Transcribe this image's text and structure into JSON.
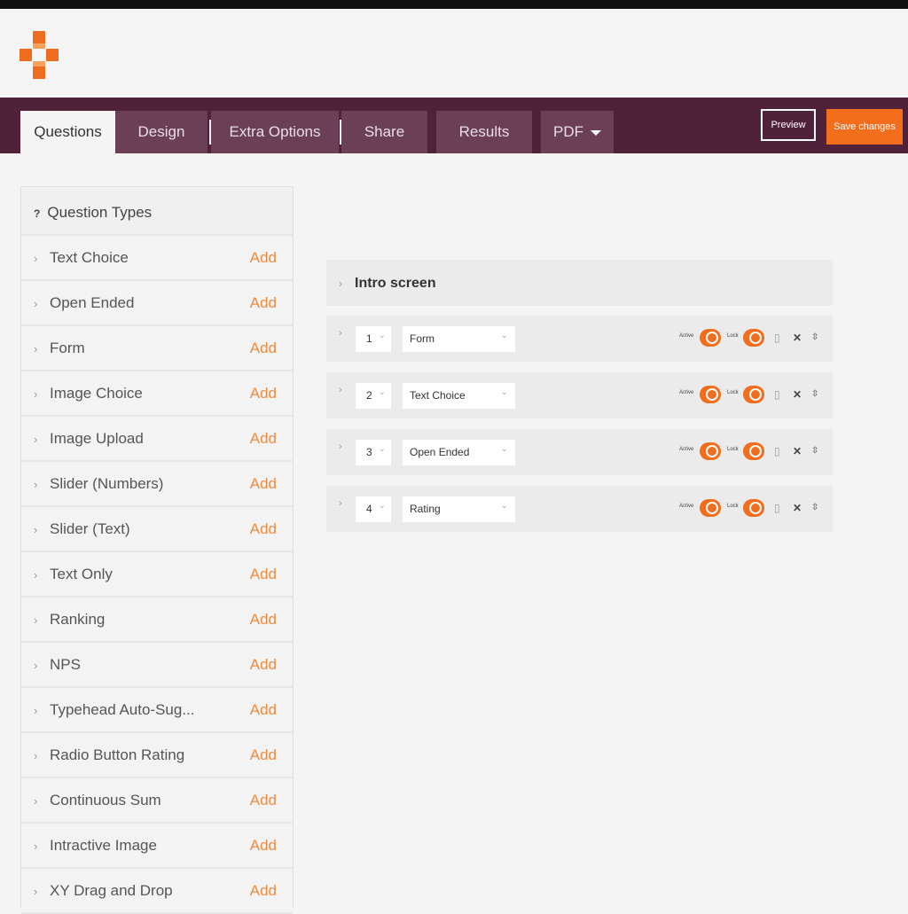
{
  "colors": {
    "brand": "#4f2239",
    "accent": "#f26d1c",
    "link": "#f08a3e"
  },
  "logo": {
    "icon": "plus-logo-icon"
  },
  "nav": {
    "tabs": [
      {
        "label": "Questions"
      },
      {
        "label": "Design"
      },
      {
        "label": "Extra Options"
      },
      {
        "label": "Share"
      },
      {
        "label": "Results"
      },
      {
        "label": "PDF"
      }
    ],
    "preview_label": "Preview",
    "save_label": "Save changes"
  },
  "sidebar": {
    "header_icon": "?",
    "header_label": "Question Types",
    "add_label": "Add",
    "items": [
      {
        "label": "Text Choice"
      },
      {
        "label": "Open Ended"
      },
      {
        "label": "Form"
      },
      {
        "label": "Image Choice"
      },
      {
        "label": "Image Upload"
      },
      {
        "label": "Slider (Numbers)"
      },
      {
        "label": "Slider (Text)"
      },
      {
        "label": "Text Only"
      },
      {
        "label": "Ranking"
      },
      {
        "label": "NPS"
      },
      {
        "label": "Typehead Auto-Sug..."
      },
      {
        "label": "Radio Button Rating"
      },
      {
        "label": "Continuous Sum"
      },
      {
        "label": "Intractive Image"
      },
      {
        "label": "XY Drag and Drop"
      }
    ]
  },
  "main": {
    "intro_label": "Intro screen",
    "active_label": "Active",
    "lock_label": "Lock",
    "questions": [
      {
        "num": "1",
        "type": "Form"
      },
      {
        "num": "2",
        "type": "Text Choice"
      },
      {
        "num": "3",
        "type": "Open Ended"
      },
      {
        "num": "4",
        "type": "Rating"
      }
    ]
  }
}
